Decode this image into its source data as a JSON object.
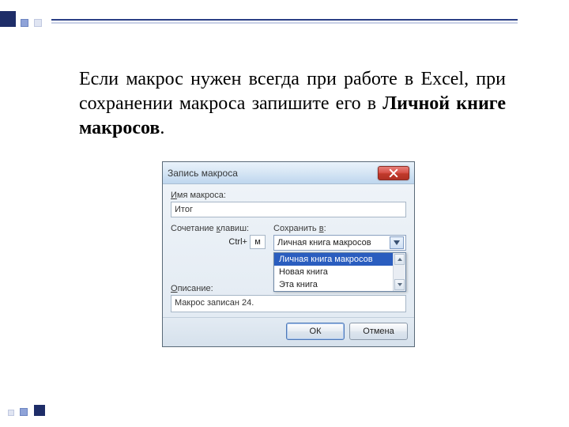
{
  "slide": {
    "paragraph_pre": "Если макрос нужен всегда при работе в Excel, при сохранении макроса запишите его в ",
    "paragraph_bold": "Личной книге макросов",
    "paragraph_post": "."
  },
  "dialog": {
    "title": "Запись макроса",
    "name_label_pre": "Имя макроса:",
    "name_hot": "И",
    "name_value": "Итог",
    "shortcut_label_pre": "Сочетание клавиш:",
    "shortcut_hot": "к",
    "ctrl_text": "Ctrl+",
    "key_value": "м",
    "save_label_pre": "Сохранить в:",
    "save_hot": "в",
    "save_value": "Личная книга макросов",
    "dropdown_options": [
      "Личная книга макросов",
      "Новая книга",
      "Эта книга"
    ],
    "desc_label_pre": "Описание:",
    "desc_hot": "О",
    "desc_value": "Макрос записан 24.",
    "ok": "ОК",
    "cancel": "Отмена"
  }
}
